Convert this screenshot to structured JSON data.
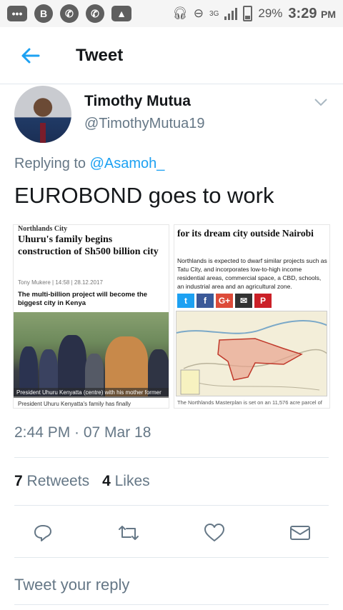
{
  "statusbar": {
    "network": "3G",
    "battery": "29%",
    "time": "3:29",
    "ampm": "PM",
    "app_icons": [
      "messages-icon",
      "b-app-icon",
      "whatsapp-icon",
      "whatsapp-icon",
      "gallery-icon"
    ]
  },
  "header": {
    "title": "Tweet"
  },
  "author": {
    "name": "Timothy Mutua",
    "handle": "@TimothyMutua19"
  },
  "reply_context": {
    "prefix": "Replying to",
    "mention": "@Asamoh_"
  },
  "tweet": {
    "text": "EUROBOND goes to work"
  },
  "media": {
    "left": {
      "kicker": "Northlands City",
      "headline": "Uhuru's family begins construction of Sh500 billion city",
      "byline": "Tony Mukere | 14:58 | 28.12.2017",
      "subhead": "The multi-billion project will become the biggest city in Kenya",
      "caption": "President Uhuru Kenyatta (centre) with his mother former",
      "caption2": "President Uhuru Kenyatta's family has finally"
    },
    "right": {
      "headline": "for its dream city outside Nairobi",
      "body": "Northlands is expected to dwarf similar projects such as Tatu City, and incorporates low-to-high income residential areas, commercial space, a CBD, schools, an industrial area and an agricultural zone.",
      "share": [
        "t",
        "f",
        "G+",
        "✉",
        "P"
      ],
      "caption": "The Northlands Masterplan is set on an 11,576 acre parcel of"
    }
  },
  "timestamp": "2:44 PM · 07 Mar 18",
  "stats": {
    "retweets_count": "7",
    "retweets_label": "Retweets",
    "likes_count": "4",
    "likes_label": "Likes"
  },
  "reply_placeholder": "Tweet your reply",
  "colors": {
    "accent": "#1da1f2",
    "muted": "#657786",
    "divider": "#e1e8ed"
  }
}
